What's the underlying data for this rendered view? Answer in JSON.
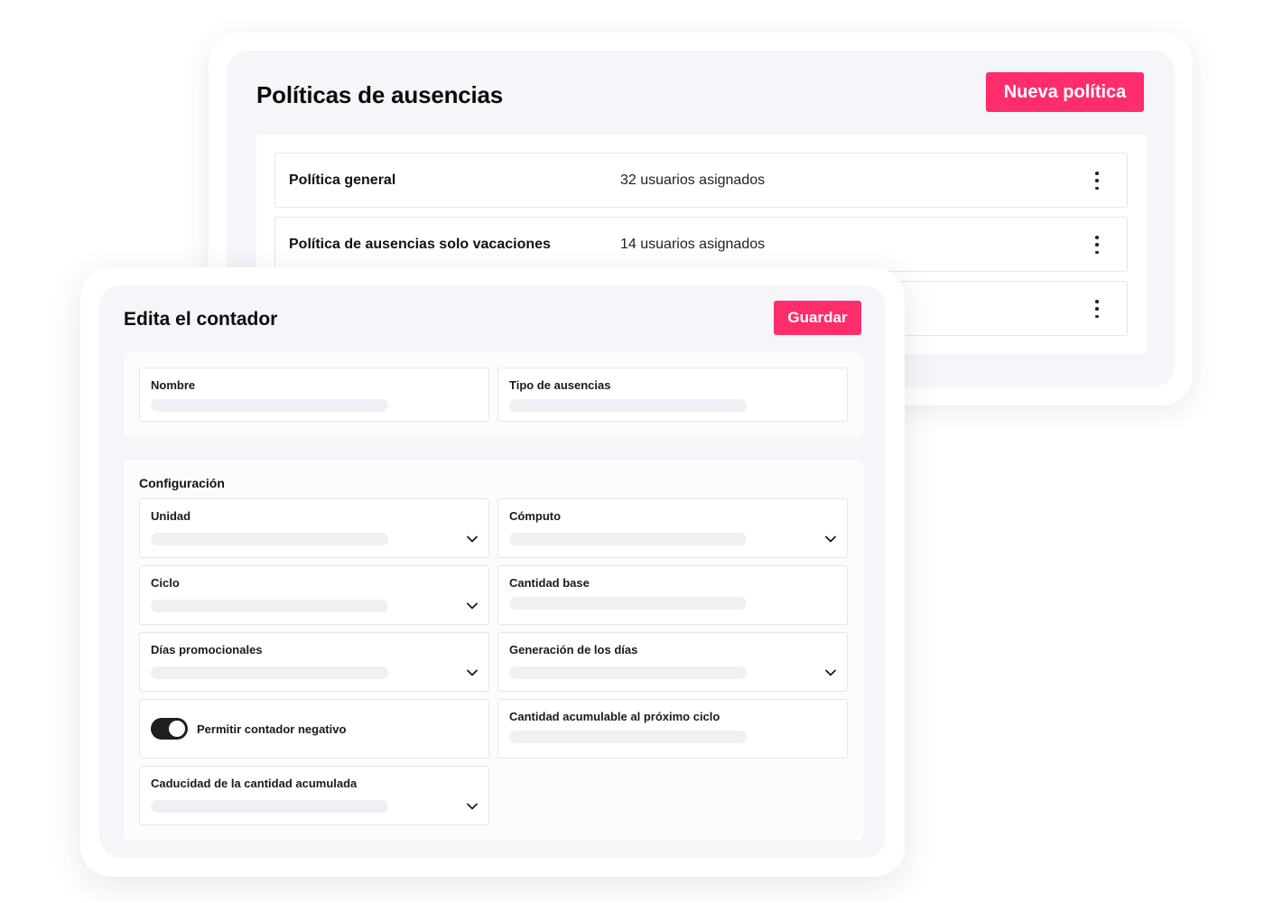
{
  "policies": {
    "title": "Políticas de ausencias",
    "new_button": "Nueva política",
    "rows": [
      {
        "name": "Política general",
        "users": "32 usuarios asignados"
      },
      {
        "name": "Política de ausencias solo vacaciones",
        "users": "14 usuarios asignados"
      },
      {
        "name": "",
        "users": ""
      }
    ]
  },
  "editor": {
    "title": "Edita el contador",
    "save_button": "Guardar",
    "top_fields": {
      "name_label": "Nombre",
      "absence_type_label": "Tipo de ausencias"
    },
    "config": {
      "title": "Configuración",
      "unit_label": "Unidad",
      "computation_label": "Cómputo",
      "cycle_label": "Ciclo",
      "base_amount_label": "Cantidad base",
      "promo_days_label": "Días promocionales",
      "days_generation_label": "Generación de los días",
      "negative_counter_label": "Permitir contador negativo",
      "negative_counter_enabled": true,
      "carryover_label": "Cantidad acumulable al próximo ciclo",
      "carryover_expiry_label": "Caducidad de la cantidad acumulada"
    }
  },
  "colors": {
    "accent": "#ff2d6b",
    "panel_bg": "#f6f5f9",
    "toggle_on": "#1f1f1f"
  },
  "icons": {
    "row_menu": "kebab-menu-icon",
    "select": "chevron-down-icon"
  }
}
